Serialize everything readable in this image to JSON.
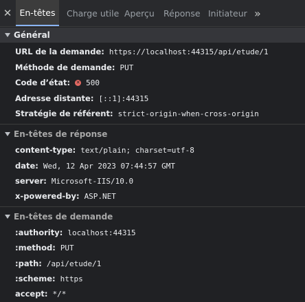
{
  "tabs": {
    "close_symbol": "✕",
    "items": [
      "En-têtes",
      "Charge utile",
      "Aperçu",
      "Réponse",
      "Initiateur"
    ],
    "more_symbol": "»"
  },
  "general": {
    "title": "Général",
    "rows": [
      {
        "key": "URL de la demande:",
        "value": "https://localhost:44315/api/etude/1"
      },
      {
        "key": "Méthode de demande:",
        "value": "PUT"
      },
      {
        "key": "Code d’état:",
        "value": "500",
        "icon": "error-icon",
        "icon_color": "#e46962"
      },
      {
        "key": "Adresse distante:",
        "value": "[::1]:44315"
      },
      {
        "key": "Stratégie de référent:",
        "value": "strict-origin-when-cross-origin"
      }
    ]
  },
  "response_headers": {
    "title": "En-têtes de réponse",
    "rows": [
      {
        "key": "content-type:",
        "value": "text/plain; charset=utf-8"
      },
      {
        "key": "date:",
        "value": "Wed, 12 Apr 2023 07:44:57 GMT"
      },
      {
        "key": "server:",
        "value": "Microsoft-IIS/10.0"
      },
      {
        "key": "x-powered-by:",
        "value": "ASP.NET"
      }
    ]
  },
  "request_headers": {
    "title": "En-têtes de demande",
    "rows": [
      {
        "key": ":authority:",
        "value": "localhost:44315"
      },
      {
        "key": ":method:",
        "value": "PUT"
      },
      {
        "key": ":path:",
        "value": "/api/etude/1"
      },
      {
        "key": ":scheme:",
        "value": "https"
      },
      {
        "key": "accept:",
        "value": "*/*"
      }
    ]
  },
  "colors": {
    "background": "#202124",
    "tabbar": "#292a2d",
    "active_tab": "#3c3c3c",
    "accent": "#8ab4f8",
    "error": "#e46962"
  }
}
